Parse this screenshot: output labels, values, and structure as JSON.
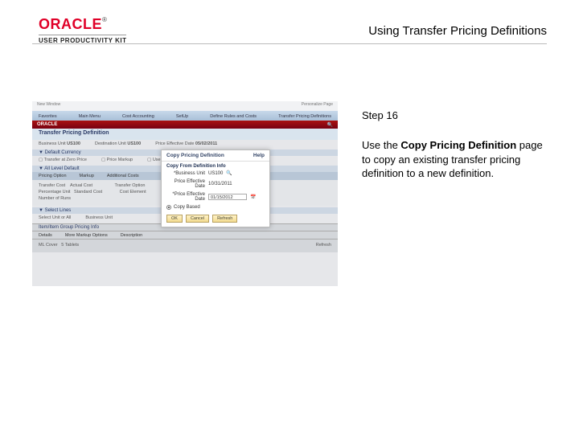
{
  "logo": {
    "brand": "ORACLE",
    "tm": "®",
    "subline": "USER PRODUCTIVITY KIT"
  },
  "header": {
    "title": "Using Transfer Pricing Definitions"
  },
  "step": {
    "label": "Step 16"
  },
  "instruction": {
    "prefix": "Use the ",
    "bold": "Copy Pricing Definition",
    "suffix": " page to copy an existing transfer pricing definition to a new definition."
  },
  "screenshot": {
    "redbar_brand": "ORACLE",
    "top_left": "New Window",
    "top_right": "Personalize Page",
    "nav_items": [
      "Favorites",
      "Main Menu",
      "Cost Accounting",
      "SetUp",
      "Define Rules and Costs",
      "Transfer Pricing Definitions"
    ],
    "page_title": "Transfer Pricing Definition",
    "bu_label": "Business Unit",
    "bu_value": "US100",
    "dest_label": "Destination Unit",
    "dest_value": "US100",
    "eff_label": "Price Effective Date",
    "eff_value": "05/02/2011",
    "sect_default": "▼ Default Currency",
    "row1a": "Transfer at Zero Price",
    "row1b": "Price Markup",
    "row1c": "Use Additional Costs",
    "sect_all": "▼ All Level Default",
    "band_pricing": "Pricing Option",
    "band_markup": "Markup",
    "band_addl": "Additional Costs",
    "f_transfer": "Transfer Cost",
    "f_actual": "Actual Cost",
    "f_percentage": "Percentage Unit",
    "f_standard": "Standard Cost",
    "f_number": "Number of Runs",
    "f_xferopt": "Transfer Option",
    "f_costel": "Cost Element",
    "sect_sel": "▼ Select Lines",
    "sel_a": "Select Unit or All",
    "sel_b": "Business Unit",
    "sect_det": "Item/Item Group Pricing Info",
    "btm_left": "Details",
    "btm_mid": "More Markup Options",
    "btm_right": "Description",
    "tbl1": "ML Cover",
    "tbl2": "5 Tablets",
    "refresh": "Refresh"
  },
  "dialog": {
    "title": "Copy Pricing Definition",
    "help": "Help",
    "section": "Copy From Definition Info",
    "field_bu_label": "*Business Unit",
    "field_bu_value": "US100",
    "field_date_label": "Price Effective Date",
    "field_date_value": "10/31/2011",
    "field_newdate_label": "*Price Effective Date",
    "field_newdate_value": "01/15/2012",
    "radio_label": "Copy Based",
    "btn_ok": "OK",
    "btn_cancel": "Cancel",
    "btn_refresh": "Refresh"
  }
}
